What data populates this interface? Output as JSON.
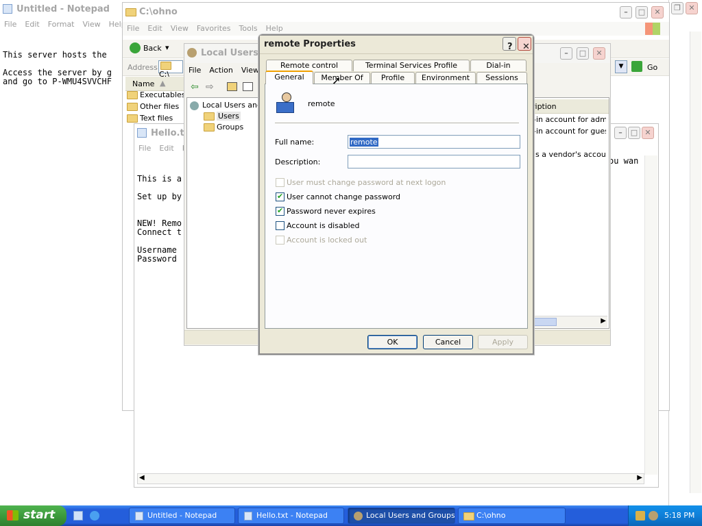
{
  "notepad1": {
    "title": "Untitled - Notepad",
    "menu": [
      "File",
      "Edit",
      "Format",
      "View",
      "Help"
    ],
    "lines": [
      "This server hosts the",
      "",
      "Access the server by g",
      "and go to P-WMU4SVVCHF"
    ]
  },
  "explorer": {
    "title": "C:\\ohno",
    "menu": [
      "File",
      "Edit",
      "View",
      "Favorites",
      "Tools",
      "Help"
    ],
    "back_label": "Back",
    "address_label": "Address",
    "address_value": "C:\\",
    "go_label": "Go",
    "name_header": "Name",
    "items": [
      "Executables",
      "Other files",
      "Text files"
    ]
  },
  "lusrmgr": {
    "title": "Local Users and Groups",
    "menu": [
      "File",
      "Action",
      "View"
    ],
    "tree_root": "Local Users and Groups",
    "tree_items": [
      "Users",
      "Groups"
    ],
    "desc_header": "ription",
    "desc_rows": [
      "-in account for adminis",
      "-in account for guest",
      "is a vendor's account"
    ]
  },
  "hello": {
    "title": "Hello.txt - Notepad",
    "menu": [
      "File",
      "Edit",
      "F"
    ],
    "lines": [
      "This is a",
      "",
      "Set up by",
      "",
      "",
      "NEW! Remo",
      "Connect t",
      "",
      "Username",
      "Password"
    ],
    "right_text": "ou wan"
  },
  "dialog": {
    "title": "remote Properties",
    "tabs_row1": [
      "Remote control",
      "Terminal Services Profile",
      "Dial-in"
    ],
    "tabs_row2": [
      "General",
      "Member Of",
      "Profile",
      "Environment",
      "Sessions"
    ],
    "username": "remote",
    "full_name_label": "Full name:",
    "full_name_value": "remote",
    "description_label": "Description:",
    "description_value": "",
    "checkboxes": [
      {
        "label": "User must change password at next logon",
        "checked": false,
        "disabled": true
      },
      {
        "label": "User cannot change password",
        "checked": true,
        "disabled": false
      },
      {
        "label": "Password never expires",
        "checked": true,
        "disabled": false
      },
      {
        "label": "Account is disabled",
        "checked": false,
        "disabled": false
      },
      {
        "label": "Account is locked out",
        "checked": false,
        "disabled": true
      }
    ],
    "ok_label": "OK",
    "cancel_label": "Cancel",
    "apply_label": "Apply"
  },
  "taskbar": {
    "start_label": "start",
    "tasks": [
      "Untitled - Notepad",
      "Hello.txt - Notepad",
      "Local Users and Groups",
      "C:\\ohno"
    ],
    "clock": "5:18 PM"
  },
  "colors": {
    "xp_blue": "#245edb",
    "start_green": "#3c9a3c",
    "tab_highlight": "#f0a000"
  }
}
